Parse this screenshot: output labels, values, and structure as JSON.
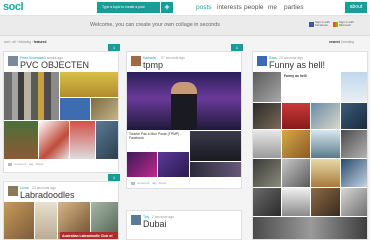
{
  "header": {
    "logo": "socl",
    "type_topic_label": "Type a topic to create a post",
    "add_symbol": "+",
    "nav": [
      "posts",
      "interests",
      "people",
      "me",
      "parties"
    ],
    "about_label": "about"
  },
  "welcome": {
    "message": "Welcome, you can create your own collage in seconds",
    "facebook_label": "Sign in with Facebook",
    "microsoft_label": "Sign in with Microsoft"
  },
  "crumbs": {
    "path": [
      "socl",
      "all",
      "following"
    ],
    "current": "featured"
  },
  "sort": {
    "current": "newest",
    "other": "trending"
  },
  "posts": [
    {
      "user": "Peter Schneider",
      "time": "3 weeks ago",
      "title": "PVC OBJECTEN",
      "actions": [
        "comment",
        "tag",
        "share"
      ]
    },
    {
      "user": "Katharia",
      "time": "27 seconds ago",
      "title": "tpmp",
      "caption": "Touche Pas à Mon Poste (TPMP) - Facebook",
      "actions": [
        "comment",
        "tag",
        "share"
      ]
    },
    {
      "user": "Rass",
      "time": "23 seconds ago",
      "title": "Funny as hell!",
      "caption": "Funny as hell!",
      "actions": [
        "comment",
        "tag",
        "share"
      ]
    },
    {
      "user": "Lorna",
      "time": "23 seconds ago",
      "title": "Labradoodles",
      "caption": "Australian Labradoodle Club of",
      "actions": [
        "comment",
        "tag",
        "share"
      ]
    },
    {
      "user": "Tidy",
      "time": "2 seconds ago",
      "title": "Dubai",
      "actions": [
        "comment",
        "tag",
        "share"
      ]
    }
  ],
  "scores": [
    "1",
    "1",
    "1"
  ],
  "colors": {
    "accent": "#1aa8a2",
    "button": "#1a9d98",
    "background": "#f4f4f4"
  }
}
